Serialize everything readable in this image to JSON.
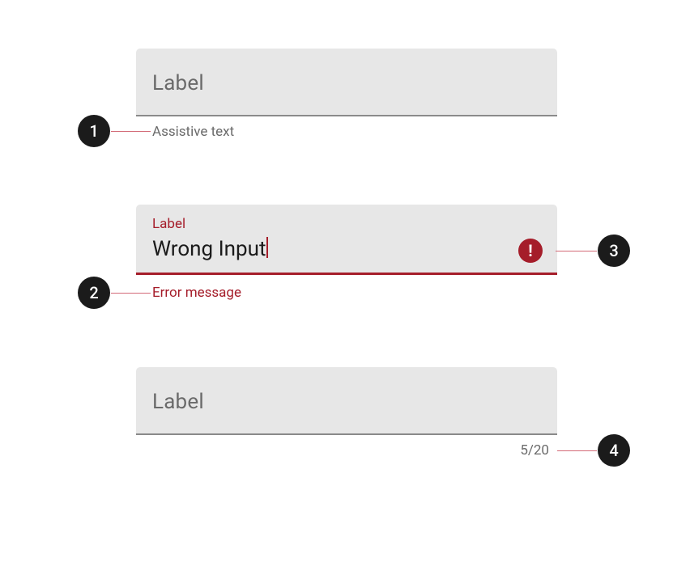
{
  "colors": {
    "error": "#a51d2a",
    "bubble": "#1b1b1b",
    "fill": "#e7e7e7"
  },
  "fields": {
    "f1": {
      "label": "Label",
      "helper": "Assistive text"
    },
    "f2": {
      "smallLabel": "Label",
      "value": "Wrong Input",
      "errorMessage": "Error message",
      "errorIcon": "!"
    },
    "f3": {
      "label": "Label",
      "counter": "5/20"
    }
  },
  "annotations": {
    "a1": "1",
    "a2": "2",
    "a3": "3",
    "a4": "4"
  }
}
